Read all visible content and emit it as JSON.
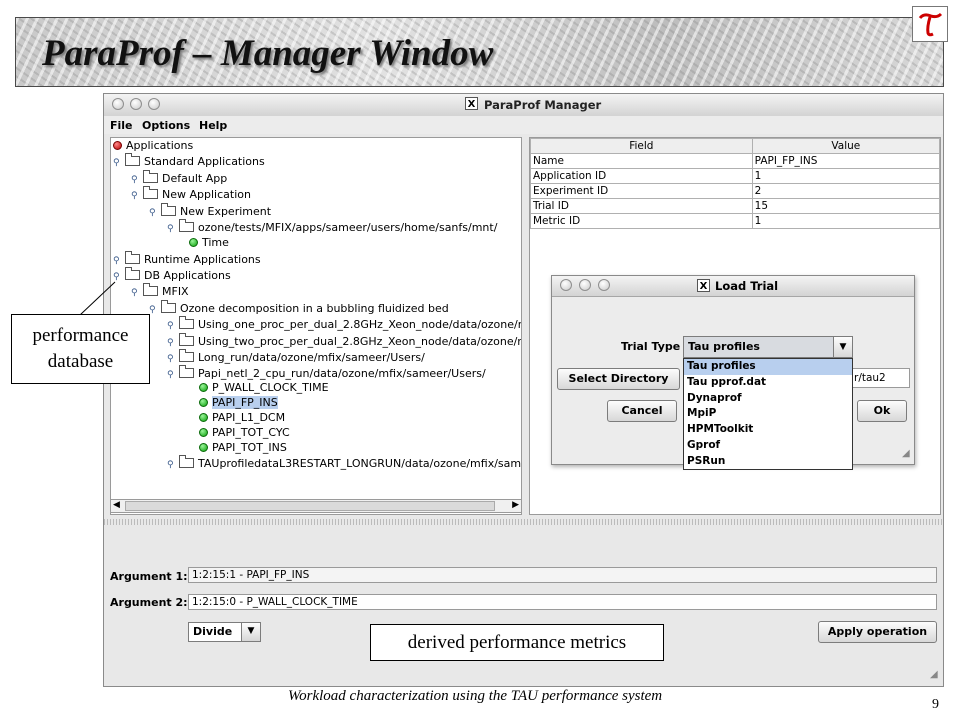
{
  "slide": {
    "title": "ParaProf  – Manager Window",
    "footer": "Workload characterization using the TAU performance system",
    "page_number": "9"
  },
  "window": {
    "title": "ParaProf Manager",
    "menu": [
      "File",
      "Options",
      "Help"
    ]
  },
  "tree": {
    "root": "Applications",
    "items": [
      "Standard Applications",
      "Default App",
      "New Application",
      "New Experiment",
      "ozone/tests/MFIX/apps/sameer/users/home/sanfs/mnt/",
      "Time",
      "Runtime Applications",
      "DB Applications",
      "MFIX",
      "Ozone decomposition in a bubbling fluidized bed",
      "Using_one_proc_per_dual_2.8GHz_Xeon_node/data/ozone/m",
      "Using_two_proc_per_dual_2.8GHz_Xeon_node/data/ozone/m",
      "Long_run/data/ozone/mfix/sameer/Users/",
      "Papi_netl_2_cpu_run/data/ozone/mfix/sameer/Users/",
      "P_WALL_CLOCK_TIME",
      "PAPI_FP_INS",
      "PAPI_L1_DCM",
      "PAPI_TOT_CYC",
      "PAPI_TOT_INS",
      "TAUprofiledataL3RESTART_LONGRUN/data/ozone/mfix/sam"
    ]
  },
  "table": {
    "headers": [
      "Field",
      "Value"
    ],
    "rows": [
      [
        "Name",
        "PAPI_FP_INS"
      ],
      [
        "Application ID",
        "1"
      ],
      [
        "Experiment ID",
        "2"
      ],
      [
        "Trial ID",
        "15"
      ],
      [
        "Metric ID",
        "1"
      ]
    ]
  },
  "dialog": {
    "title": "Load Trial",
    "trial_type_label": "Trial Type",
    "selected": "Tau profiles",
    "options": [
      "Tau profiles",
      "Tau pprof.dat",
      "Dynaprof",
      "MpiP",
      "HPMToolkit",
      "Gprof",
      "PSRun"
    ],
    "select_directory": "Select Directory",
    "path_value": "r/tau2",
    "cancel": "Cancel",
    "ok": "Ok"
  },
  "operation": {
    "arg1_label": "Argument 1:",
    "arg1_value": "1:2:15:1 - PAPI_FP_INS",
    "arg2_label": "Argument 2:",
    "arg2_value": "1:2:15:0 - P_WALL_CLOCK_TIME",
    "operator": "Divide",
    "apply": "Apply operation"
  },
  "annotations": {
    "perf_db": [
      "performance",
      "database"
    ],
    "derived": "derived performance metrics"
  }
}
